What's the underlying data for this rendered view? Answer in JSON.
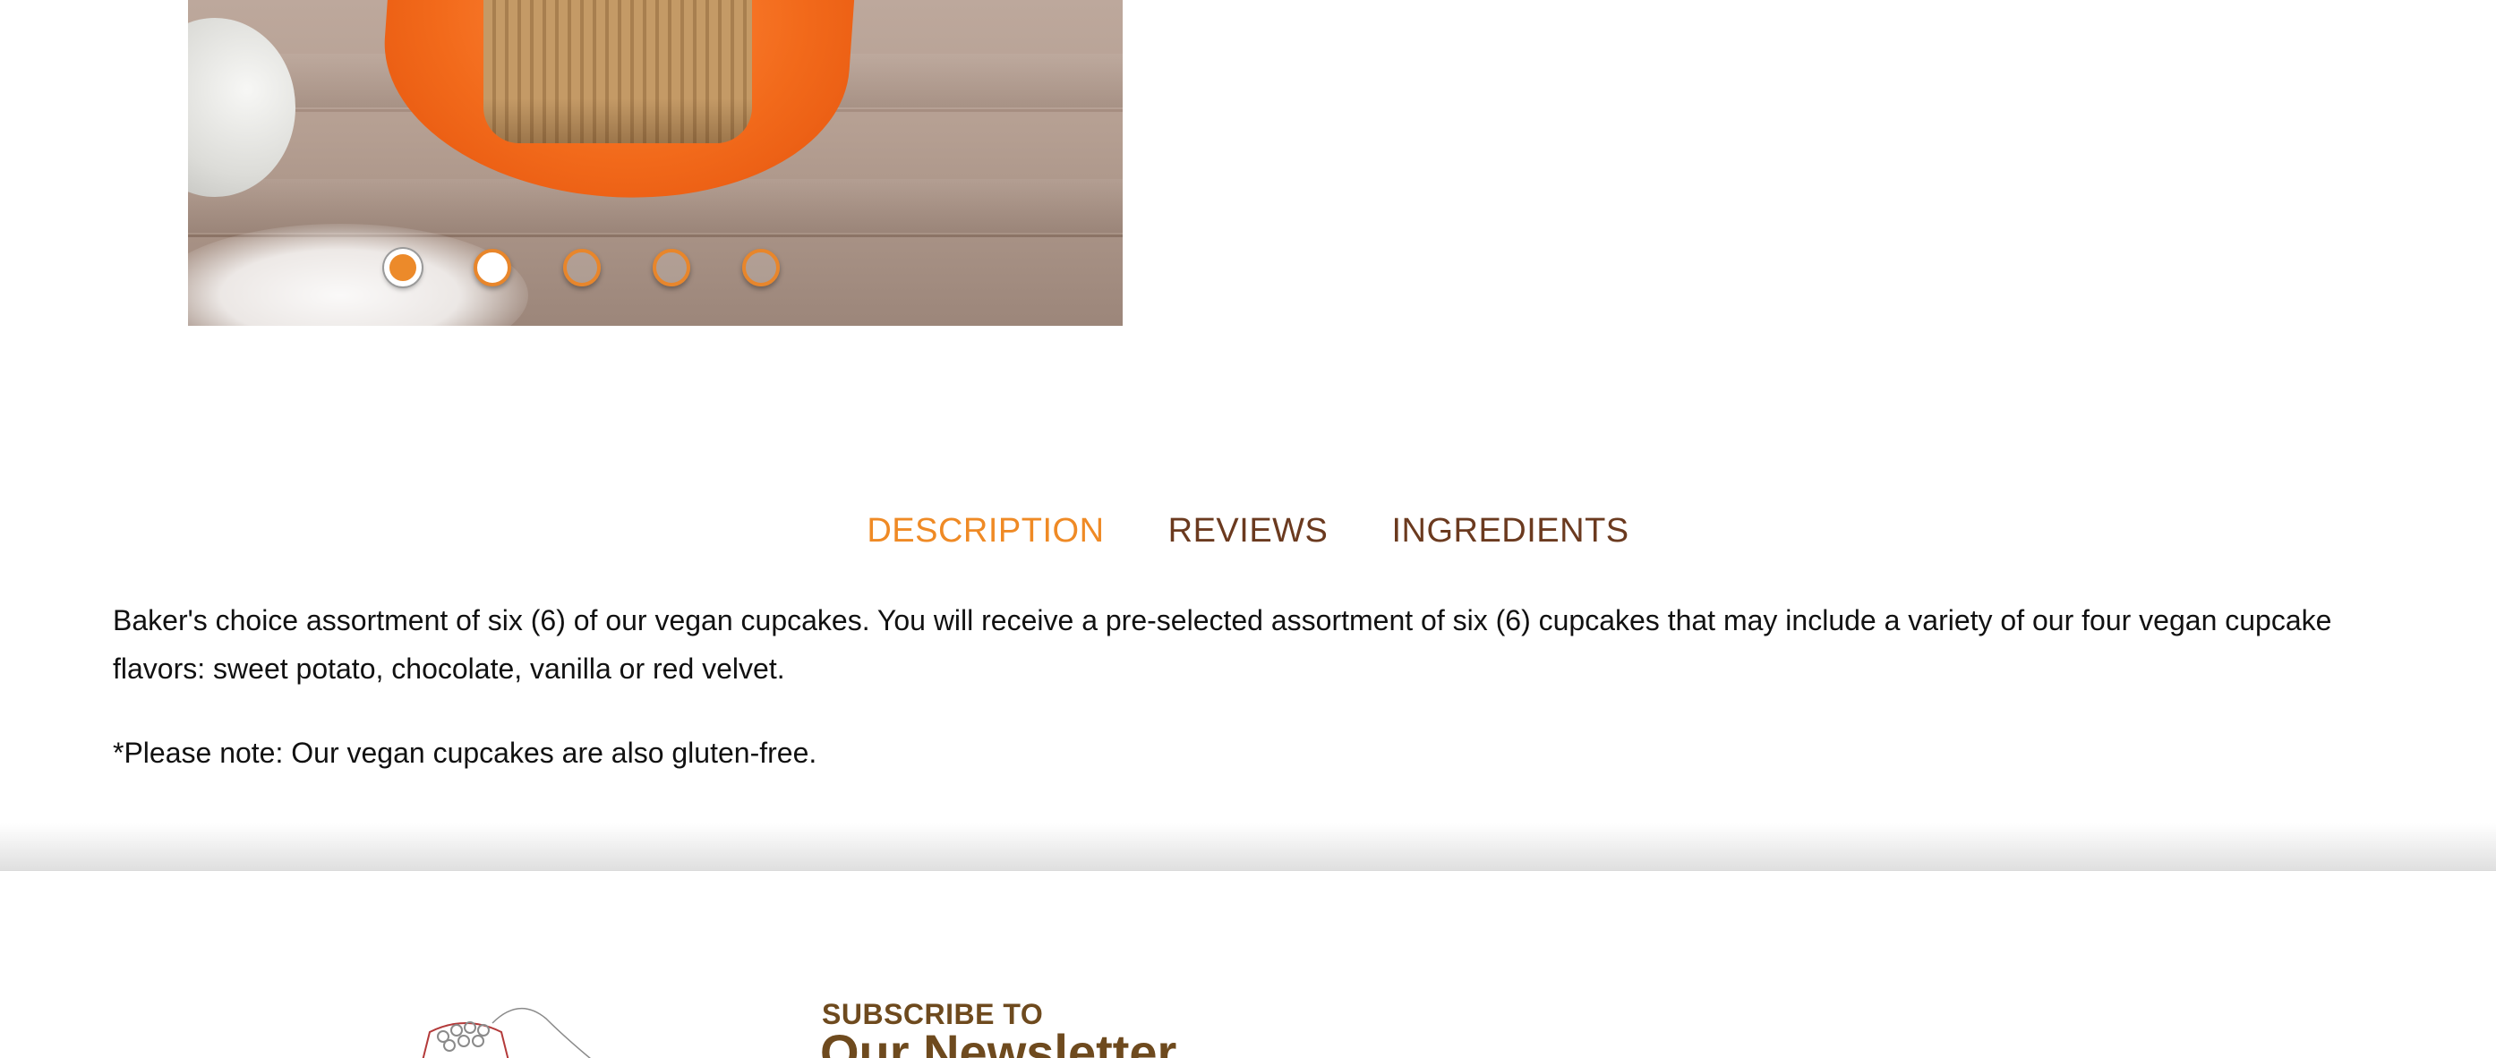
{
  "gallery": {
    "image_description": "cupcake-image",
    "dots": [
      {
        "state": "active"
      },
      {
        "state": "white"
      },
      {
        "state": "inactive"
      },
      {
        "state": "inactive"
      },
      {
        "state": "inactive"
      }
    ],
    "current_slide": 1,
    "slide_count": 5
  },
  "tabs": {
    "description": "DESCRIPTION",
    "reviews": "REVIEWS",
    "ingredients": "INGREDIENTS",
    "active": "DESCRIPTION"
  },
  "description": {
    "paragraph_1": "Baker's choice assortment of six (6) of our vegan cupcakes. You will receive a pre-selected assortment of six (6) cupcakes that may include a variety of our four vegan cupcake flavors: sweet potato, chocolate, vanilla or red velvet.",
    "paragraph_2": "*Please note: Our vegan cupcakes are also gluten-free."
  },
  "newsletter": {
    "kicker": "SUBSCRIBE TO",
    "title": "Our Newsletter"
  },
  "colors": {
    "accent_orange": "#ef8a25",
    "tab_brown": "#6b3a1f",
    "newsletter_brown": "#6e4a1e",
    "text": "#111111"
  }
}
